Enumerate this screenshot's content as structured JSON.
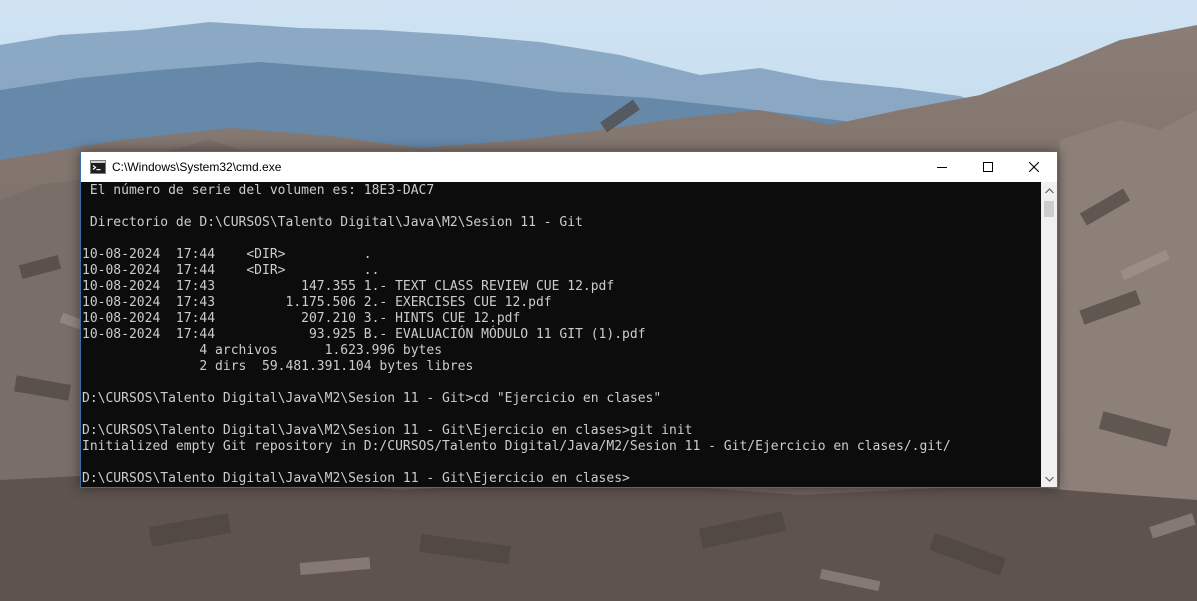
{
  "window": {
    "title": "C:\\Windows\\System32\\cmd.exe",
    "icon": "cmd-icon",
    "caption_buttons": [
      "minimize-icon",
      "maximize-icon",
      "close-icon"
    ]
  },
  "console": {
    "lines": [
      " El número de serie del volumen es: 18E3-DAC7",
      "",
      " Directorio de D:\\CURSOS\\Talento Digital\\Java\\M2\\Sesion 11 - Git",
      "",
      "10-08-2024  17:44    <DIR>          .",
      "10-08-2024  17:44    <DIR>          ..",
      "10-08-2024  17:43           147.355 1.- TEXT CLASS REVIEW CUE 12.pdf",
      "10-08-2024  17:43         1.175.506 2.- EXERCISES CUE 12.pdf",
      "10-08-2024  17:44           207.210 3.- HINTS CUE 12.pdf",
      "10-08-2024  17:44            93.925 B.- EVALUACIÓN MÓDULO 11 GIT (1).pdf",
      "               4 archivos      1.623.996 bytes",
      "               2 dirs  59.481.391.104 bytes libres",
      "",
      "D:\\CURSOS\\Talento Digital\\Java\\M2\\Sesion 11 - Git>cd \"Ejercicio en clases\"",
      "",
      "D:\\CURSOS\\Talento Digital\\Java\\M2\\Sesion 11 - Git\\Ejercicio en clases>git init",
      "Initialized empty Git repository in D:/CURSOS/Talento Digital/Java/M2/Sesion 11 - Git/Ejercicio en clases/.git/",
      "",
      "D:\\CURSOS\\Talento Digital\\Java\\M2\\Sesion 11 - Git\\Ejercicio en clases>"
    ]
  },
  "colors": {
    "console_background": "#0c0c0c",
    "console_text": "#cccccc",
    "titlebar_background": "#ffffff"
  }
}
